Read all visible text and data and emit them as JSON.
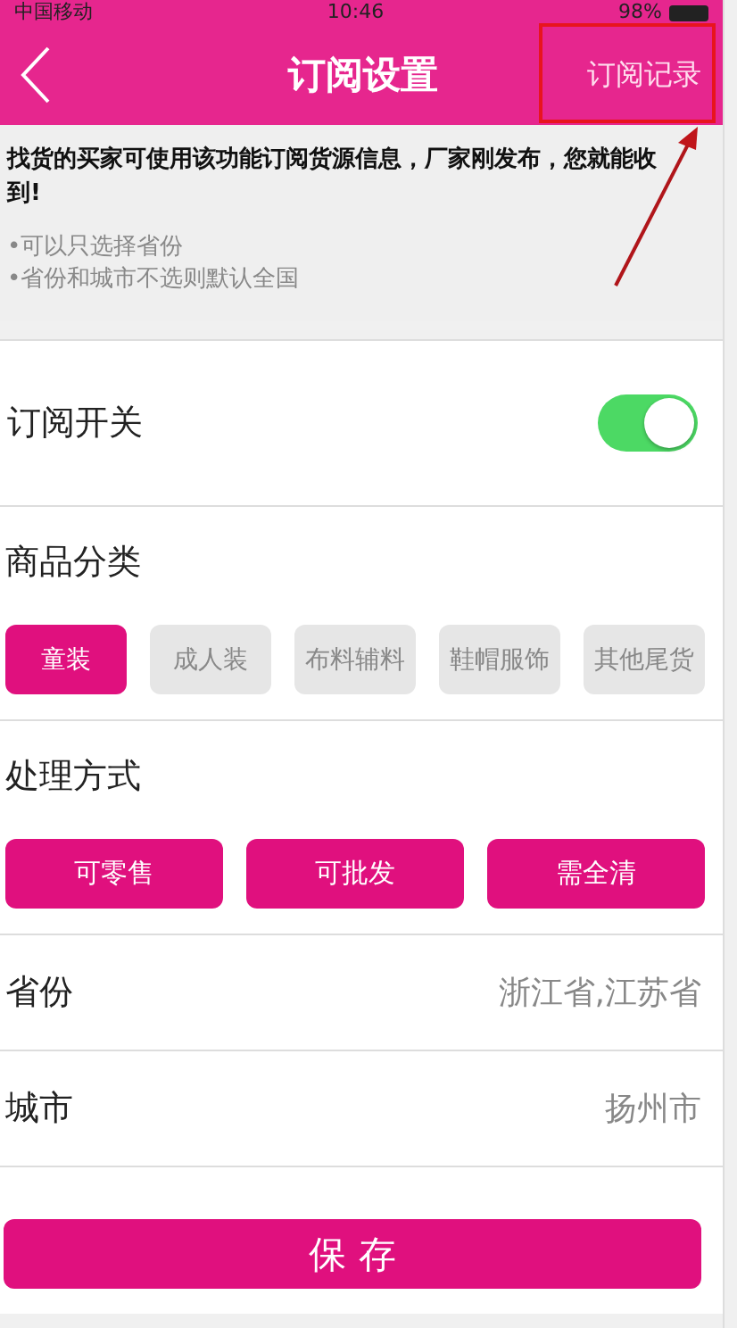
{
  "status_bar": {
    "carrier": "中国移动",
    "time": "10:46",
    "battery": "98%"
  },
  "nav": {
    "title": "订阅设置",
    "right_action": "订阅记录"
  },
  "notice": {
    "text": "找货的买家可使用该功能订阅货源信息，厂家刚发布，您就能收到!",
    "tips": [
      "•可以只选择省份",
      "•省份和城市不选则默认全国"
    ]
  },
  "subscription_switch": {
    "label": "订阅开关",
    "on": true
  },
  "category": {
    "label": "商品分类",
    "options": [
      {
        "label": "童装",
        "selected": true
      },
      {
        "label": "成人装",
        "selected": false
      },
      {
        "label": "布料辅料",
        "selected": false
      },
      {
        "label": "鞋帽服饰",
        "selected": false
      },
      {
        "label": "其他尾货",
        "selected": false
      }
    ]
  },
  "handling": {
    "label": "处理方式",
    "options": [
      {
        "label": "可零售",
        "selected": true
      },
      {
        "label": "可批发",
        "selected": true
      },
      {
        "label": "需全清",
        "selected": true
      }
    ]
  },
  "fields": [
    {
      "label": "省份",
      "value": "浙江省,江苏省"
    },
    {
      "label": "城市",
      "value": "扬州市"
    }
  ],
  "save_button": "保 存"
}
